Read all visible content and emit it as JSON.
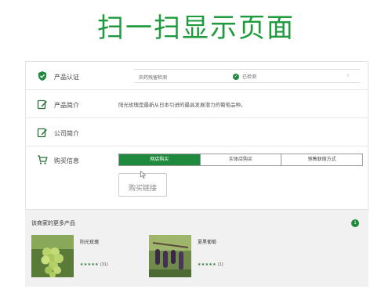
{
  "header": {
    "title": "扫一扫显示页面"
  },
  "rows": {
    "cert": {
      "label": "产品认证",
      "name": "农药残留检测",
      "status": "已检测",
      "arrow": "›",
      "check": "✓"
    },
    "intro": {
      "label": "产品简介",
      "text": "阳光玫瑰是最新从日本引进的最具发展潜力的葡萄品种。"
    },
    "company": {
      "label": "公司简介"
    },
    "buy": {
      "label": "购买信息",
      "tabs": [
        "网店购买",
        "实体店购买",
        "销售联络方式"
      ],
      "button": "购买链接"
    }
  },
  "more": {
    "title": "该商家的更多产品",
    "badge": "1",
    "products": [
      {
        "name": "阳光玫瑰",
        "stars": "★★★★★",
        "count": "(31)"
      },
      {
        "name": "夏黑葡萄",
        "stars": "★★★★★",
        "count": "(1)"
      }
    ]
  },
  "colors": {
    "accent": "#1f8a3e",
    "title": "#1f9a3d"
  }
}
